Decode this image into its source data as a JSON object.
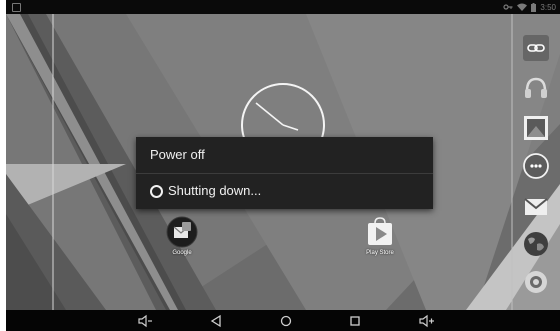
{
  "status_bar": {
    "time": "3:50",
    "icons": [
      "key-icon",
      "wifi-icon",
      "battery-icon"
    ]
  },
  "desktop": {
    "apps": [
      {
        "label": "Google",
        "icon": "google-folder-icon"
      },
      {
        "label": "Play Store",
        "icon": "play-store-icon"
      }
    ],
    "widgets": [
      "analog-clock"
    ]
  },
  "dock": {
    "icons": [
      "link-icon",
      "headphones-icon",
      "gallery-icon",
      "app-drawer-icon",
      "gmail-icon",
      "globe-icon",
      "settings-icon"
    ]
  },
  "dialog": {
    "title": "Power off",
    "message": "Shutting down..."
  },
  "nav_bar": {
    "buttons": [
      "volume-down-icon",
      "back-icon",
      "home-icon",
      "recents-icon",
      "volume-up-icon"
    ]
  }
}
